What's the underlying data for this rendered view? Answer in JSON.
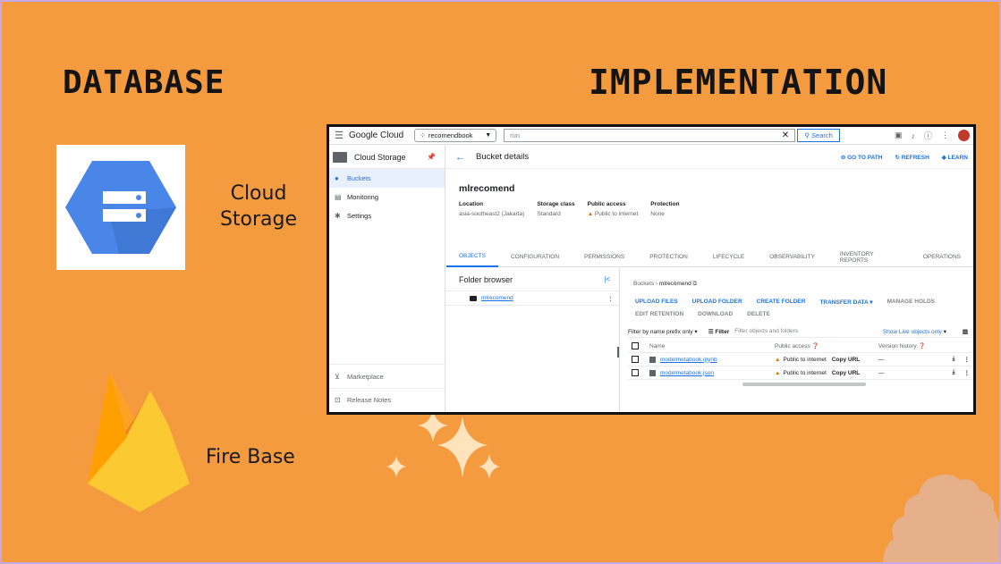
{
  "slide": {
    "title_left": "DATABASE",
    "title_right": "IMPLEMENTATION",
    "cloud_storage_label_line1": "Cloud",
    "cloud_storage_label_line2": "Storage",
    "firebase_label": "Fire Base"
  },
  "console": {
    "brand": "Google Cloud",
    "project": "recomendbook",
    "search_value": "run",
    "search_button": "Search",
    "product": "Cloud Storage",
    "nav": [
      {
        "label": "Buckets",
        "icon": "bucket-icon"
      },
      {
        "label": "Monitoring",
        "icon": "chart-icon"
      },
      {
        "label": "Settings",
        "icon": "gear-icon"
      }
    ],
    "nav_bottom": [
      {
        "label": "Marketplace",
        "icon": "marketplace-icon"
      },
      {
        "label": "Release Notes",
        "icon": "notes-icon"
      }
    ],
    "page_title": "Bucket details",
    "header_actions": [
      "GO TO PATH",
      "REFRESH",
      "LEARN"
    ],
    "bucket_name": "mlrecomend",
    "props": {
      "location_k": "Location",
      "location_v": "asia-southeast2 (Jakarta)",
      "storage_k": "Storage class",
      "storage_v": "Standard",
      "access_k": "Public access",
      "access_v": "Public to internet",
      "protection_k": "Protection",
      "protection_v": "None"
    },
    "tabs": [
      "OBJECTS",
      "CONFIGURATION",
      "PERMISSIONS",
      "PROTECTION",
      "LIFECYCLE",
      "OBSERVABILITY",
      "INVENTORY REPORTS",
      "OPERATIONS"
    ],
    "folder_browser": "Folder browser",
    "folder_item": "mlrecomend",
    "breadcrumb_root": "Buckets",
    "breadcrumb_current": "mlrecomend",
    "actions_row1": [
      "UPLOAD FILES",
      "UPLOAD FOLDER",
      "CREATE FOLDER",
      "TRANSFER DATA",
      "MANAGE HOLDS"
    ],
    "actions_row2": [
      "EDIT RETENTION",
      "DOWNLOAD",
      "DELETE"
    ],
    "filter_prefix": "Filter by name prefix only",
    "filter_label": "Filter",
    "filter_placeholder": "Filter objects and folders",
    "show_label": "Show",
    "show_value": "Live objects only",
    "columns": {
      "name": "Name",
      "public_access": "Public access",
      "version_history": "Version history"
    },
    "rows": [
      {
        "name": "modelmetabook.ipynb",
        "access": "Public to internet",
        "copy": "Copy URL",
        "version": "—"
      },
      {
        "name": "modelmetabook.json",
        "access": "Public to internet",
        "copy": "Copy URL",
        "version": "—"
      }
    ]
  }
}
